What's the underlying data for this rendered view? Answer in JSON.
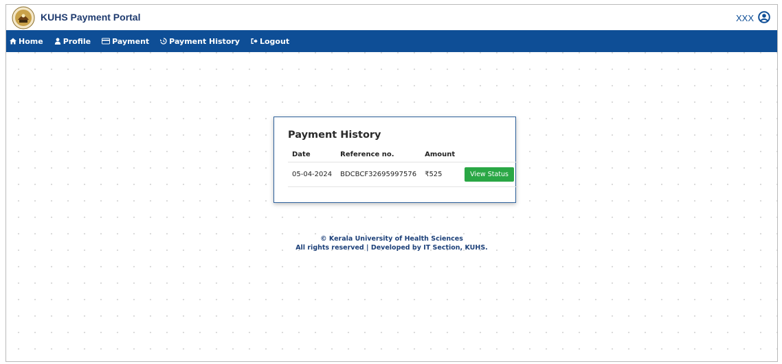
{
  "header": {
    "brand": "KUHS Payment Portal",
    "user_name": "XXX",
    "logo_icon": "university-seal-icon",
    "user_icon": "user-circle-icon"
  },
  "nav": {
    "items": [
      {
        "label": "Home",
        "icon": "home-icon"
      },
      {
        "label": "Profile",
        "icon": "user-icon"
      },
      {
        "label": "Payment",
        "icon": "credit-card-icon"
      },
      {
        "label": "Payment History",
        "icon": "history-icon"
      },
      {
        "label": "Logout",
        "icon": "sign-out-icon"
      }
    ]
  },
  "payment_history": {
    "title": "Payment History",
    "columns": [
      "Date",
      "Reference no.",
      "Amount",
      ""
    ],
    "rows": [
      {
        "date": "05-04-2024",
        "reference": "BDCBCF32695997576",
        "amount": "₹525",
        "action_label": "View Status"
      }
    ]
  },
  "footer": {
    "line1": "© Kerala University of Health Sciences",
    "line2": "All rights reserved | Developed by IT Section, KUHS."
  },
  "colors": {
    "nav_background": "#0e4e96",
    "brand_text": "#1e3a6e",
    "button_green": "#2aa745",
    "footer_text": "#1b3f78"
  }
}
